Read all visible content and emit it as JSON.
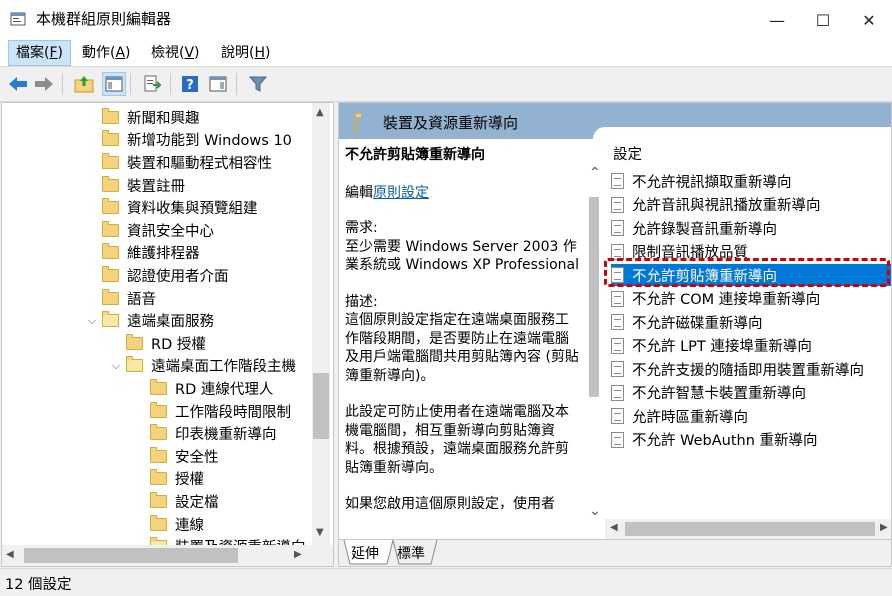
{
  "window": {
    "title": "本機群組原則編輯器",
    "minimize": "—",
    "maximize": "☐",
    "close": "✕"
  },
  "menu": [
    {
      "label": "檔案(",
      "mnemonic": "F",
      "suffix": ")"
    },
    {
      "label": "動作(",
      "mnemonic": "A",
      "suffix": ")"
    },
    {
      "label": "檢視(",
      "mnemonic": "V",
      "suffix": ")"
    },
    {
      "label": "說明(",
      "mnemonic": "H",
      "suffix": ")"
    }
  ],
  "toolbar": {
    "icons": [
      "back-arrow-icon",
      "forward-arrow-icon",
      "up-folder-icon",
      "show-hide-tree-icon",
      "export-list-icon",
      "help-icon",
      "show-action-pane-icon",
      "filter-icon"
    ]
  },
  "tree": {
    "items": [
      {
        "label": "新聞和興趣"
      },
      {
        "label": "新增功能到 Windows 10"
      },
      {
        "label": "裝置和驅動程式相容性"
      },
      {
        "label": "裝置註冊"
      },
      {
        "label": "資料收集與預覽組建"
      },
      {
        "label": "資訊安全中心"
      },
      {
        "label": "維護排程器"
      },
      {
        "label": "認證使用者介面"
      },
      {
        "label": "語音"
      },
      {
        "label": "遠端桌面服務"
      },
      {
        "label": "RD 授權"
      },
      {
        "label": "遠端桌面工作階段主機"
      },
      {
        "label": "RD 連線代理人"
      },
      {
        "label": "工作階段時間限制"
      },
      {
        "label": "印表機重新導向"
      },
      {
        "label": "安全性"
      },
      {
        "label": "授權"
      },
      {
        "label": "設定檔"
      },
      {
        "label": "連線"
      },
      {
        "label": "裝置及資源重新導向"
      }
    ]
  },
  "right": {
    "header": "裝置及資源重新導向",
    "desc": {
      "title": "不允許剪貼簿重新導向",
      "edit_prefix": "編輯",
      "edit_link": "原則設定",
      "req_label": "需求:",
      "req_text": "至少需要 Windows Server 2003 作業系統或 Windows XP Professional",
      "desc_label": "描述:",
      "desc_text1": "這個原則設定指定在遠端桌面服務工作階段期間，是否要防止在遠端電腦及用戶端電腦間共用剪貼簿內容 (剪貼簿重新導向)。",
      "desc_text2": "此設定可防止使用者在遠端電腦及本機電腦間，相互重新導向剪貼簿資料。根據預設，遠端桌面服務允許剪貼簿重新導向。",
      "desc_text3": "如果您啟用這個原則設定，使用者"
    },
    "list_header": "設定",
    "settings": [
      {
        "label": "不允許視訊擷取重新導向"
      },
      {
        "label": "允許音訊與視訊播放重新導向"
      },
      {
        "label": "允許錄製音訊重新導向"
      },
      {
        "label": "限制音訊播放品質"
      },
      {
        "label": "不允許剪貼簿重新導向"
      },
      {
        "label": "不允許 COM 連接埠重新導向"
      },
      {
        "label": "不允許磁碟重新導向"
      },
      {
        "label": "不允許 LPT 連接埠重新導向"
      },
      {
        "label": "不允許支援的隨插即用裝置重新導向"
      },
      {
        "label": "不允許智慧卡裝置重新導向"
      },
      {
        "label": "允許時區重新導向"
      },
      {
        "label": "不允許 WebAuthn 重新導向"
      }
    ],
    "selected_setting": "不允許剪貼簿重新導向",
    "tabs": [
      {
        "label": "延伸"
      },
      {
        "label": "標準"
      }
    ]
  },
  "status": {
    "text": "12 個設定"
  },
  "colors": {
    "accent": "#0078d7",
    "header_band": "#93b2d2",
    "highlight_outline": "#d40000",
    "link": "#0a5fb4"
  }
}
